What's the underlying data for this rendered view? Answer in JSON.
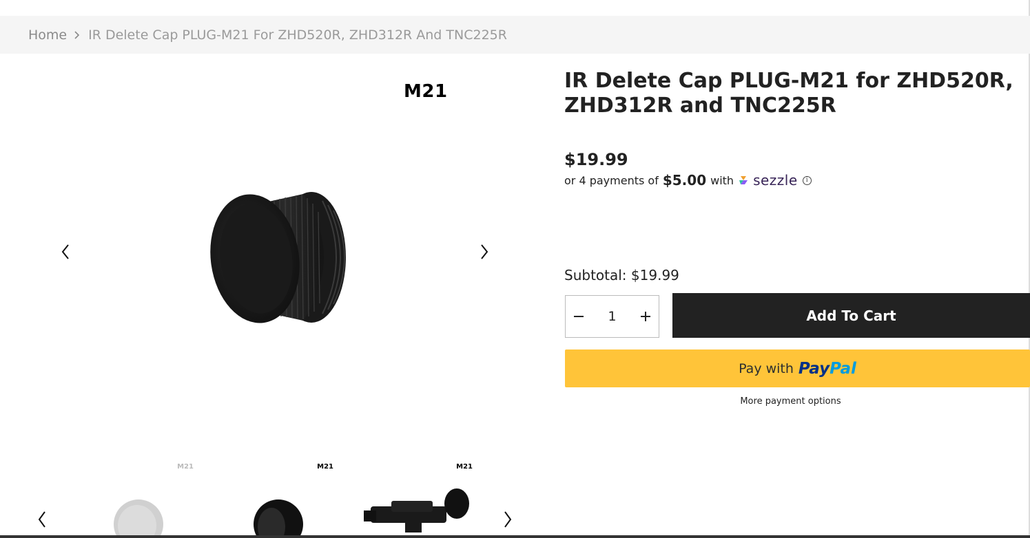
{
  "breadcrumb": {
    "home": "Home",
    "current": "IR Delete Cap PLUG-M21 For ZHD520R, ZHD312R And TNC225R",
    "separator_icon": "chevron-right-icon"
  },
  "gallery": {
    "main_label": "M21",
    "prev_icon": "chevron-left-icon",
    "next_icon": "chevron-right-icon",
    "thumbnails": [
      {
        "label": "M21",
        "image": "cap-faded"
      },
      {
        "label": "M21",
        "image": "cap-side"
      },
      {
        "label": "M21",
        "image": "thermal-scope"
      }
    ]
  },
  "product": {
    "title": "IR Delete Cap PLUG-M21 for ZHD520R, ZHD312R and TNC225R",
    "price": "$19.99",
    "sezzle": {
      "prefix": "or 4 payments of",
      "installment": "$5.00",
      "with": "with",
      "brand": "sezzle",
      "info_icon": "info-icon"
    },
    "subtotal_label": "Subtotal:",
    "subtotal_value": "$19.99",
    "quantity": "1",
    "add_to_cart": "Add To Cart",
    "paypal": {
      "pay_with": "Pay with",
      "brand_a": "Pay",
      "brand_b": "Pal"
    },
    "more_payment_options": "More payment options"
  },
  "colors": {
    "breadcrumb_bg": "#f5f5f5",
    "cart_button": "#222222",
    "paypal_yellow": "#ffc439",
    "paypal_dark": "#003087",
    "paypal_light": "#009cde",
    "sezzle_purple": "#392558"
  }
}
